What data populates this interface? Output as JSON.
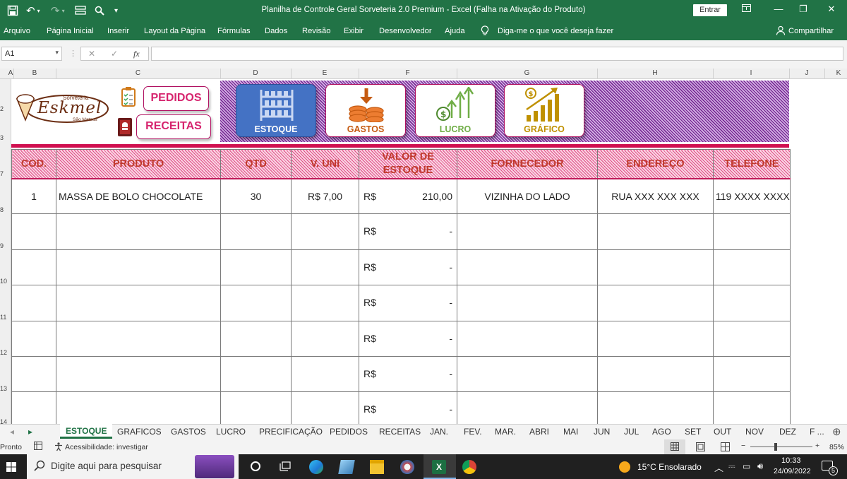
{
  "window": {
    "title": "Planilha de Controle Geral Sorveteria 2.0 Premium  -  Excel (Falha na Ativação do Produto)",
    "signin_label": "Entrar"
  },
  "ribbon": {
    "tabs": [
      "Arquivo",
      "Página Inicial",
      "Inserir",
      "Layout da Página",
      "Fórmulas",
      "Dados",
      "Revisão",
      "Exibir",
      "Desenvolvedor",
      "Ajuda"
    ],
    "tell_me": "Diga-me o que você deseja fazer",
    "share": "Compartilhar"
  },
  "formula_bar": {
    "name_box": "A1",
    "formula": ""
  },
  "columns": [
    "A",
    "B",
    "C",
    "D",
    "E",
    "F",
    "G",
    "H",
    "I",
    "J",
    "K"
  ],
  "rows": [
    "2",
    "3",
    "7",
    "8",
    "9",
    "10",
    "11",
    "12",
    "13",
    "14"
  ],
  "logo": {
    "brand": "Eskmel",
    "line1": "Sorveteria",
    "line2": "São Mateus"
  },
  "controls": {
    "pedidos": "PEDIDOS",
    "receitas": "RECEITAS"
  },
  "nav": {
    "estoque": "ESTOQUE",
    "gastos": "GASTOS",
    "lucro": "LUCRO",
    "grafico": "GRÁFICO"
  },
  "colors": {
    "excel_green": "#217346",
    "brand_pink": "#d6246e",
    "estoque_blue": "#4472c4",
    "gastos_orange": "#c55a11",
    "lucro_green": "#70ad47",
    "grafico_gold": "#bf9000"
  },
  "table": {
    "headers": [
      "COD.",
      "PRODUTO",
      "QTD",
      "V. UNI",
      "VALOR DE ESTOQUE",
      "FORNECEDOR",
      "ENDEREÇO",
      "TELEFONE"
    ],
    "rows": [
      [
        "1",
        "MASSA DE BOLO CHOCOLATE",
        "30",
        "R$ 7,00",
        "R$",
        "210,00",
        "VIZINHA DO LADO",
        "RUA XXX XXX XXX",
        "119 XXXX XXXX"
      ],
      [
        "",
        "",
        "",
        "",
        "R$",
        "-",
        "",
        "",
        ""
      ],
      [
        "",
        "",
        "",
        "",
        "R$",
        "-",
        "",
        "",
        ""
      ],
      [
        "",
        "",
        "",
        "",
        "R$",
        "-",
        "",
        "",
        ""
      ],
      [
        "",
        "",
        "",
        "",
        "R$",
        "-",
        "",
        "",
        ""
      ],
      [
        "",
        "",
        "",
        "",
        "R$",
        "-",
        "",
        "",
        ""
      ],
      [
        "",
        "",
        "",
        "",
        "R$",
        "-",
        "",
        "",
        ""
      ]
    ]
  },
  "sheet_tabs": [
    "ESTOQUE",
    "GRAFICOS",
    "GASTOS",
    "LUCRO",
    "PRECIFICAÇÃO",
    "PEDIDOS",
    "RECEITAS",
    "JAN.",
    "FEV.",
    "MAR.",
    "ABRI",
    "MAI",
    "JUN",
    "JUL",
    "AGO",
    "SET",
    "OUT",
    "NOV",
    "DEZ",
    "F ..."
  ],
  "status": {
    "mode": "Pronto",
    "accessibility": "Acessibilidade: investigar",
    "zoom": "85%",
    "zoom_level": 0.85
  },
  "taskbar": {
    "search_placeholder": "Digite aqui para pesquisar",
    "weather": "15°C  Ensolarado",
    "time": "10:33",
    "date": "24/09/2022",
    "notifications": "5"
  }
}
